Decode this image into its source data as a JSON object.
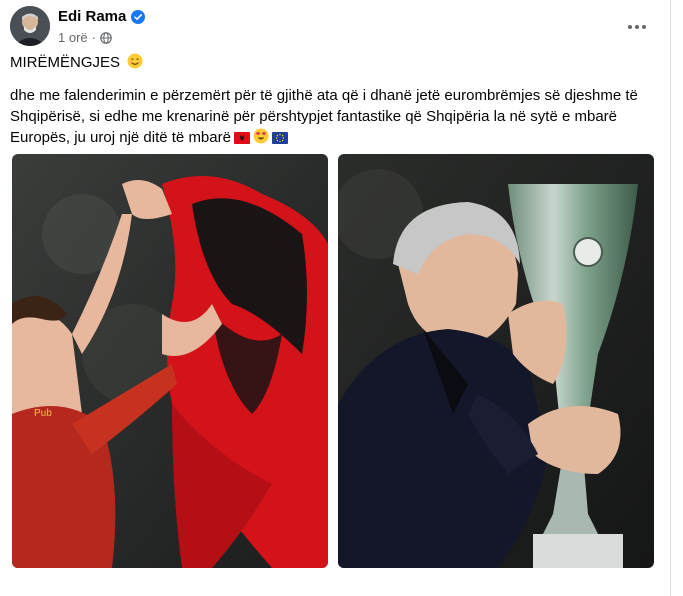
{
  "post": {
    "author": "Edi Rama",
    "time": "1 orë",
    "greeting": "MIRËMËNGJES",
    "body": "dhe me falenderimin e përzemërt për të gjithë ata që i dhanë jetë eurombrëmjes së djeshme të Shqipërisë, si edhe me krenarinë për përshtypjet fantastike që Shqipëria la në sytë e mbarë Europës, ju uroj një ditë të mbarë",
    "icons": {
      "verified": "verified-badge-icon",
      "audience": "globe-icon",
      "more": "more-options-icon"
    },
    "colors": {
      "verified": "#1877f2",
      "secondary_text": "#65676b",
      "flag_red": "#e30a17"
    }
  }
}
